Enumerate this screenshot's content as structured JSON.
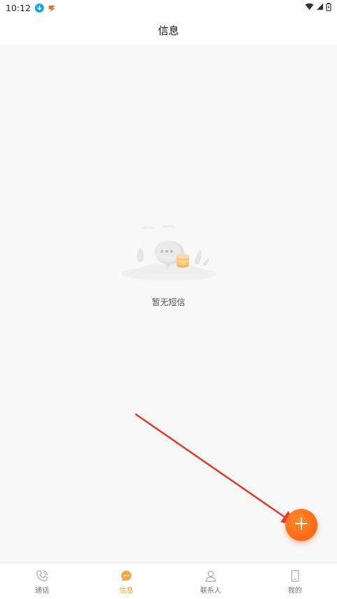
{
  "status_bar": {
    "time": "10:12"
  },
  "header": {
    "title": "信息"
  },
  "empty_state": {
    "text": "暂无短信"
  },
  "tabs": [
    {
      "label": "通话",
      "icon": "phone-icon",
      "active": false
    },
    {
      "label": "信息",
      "icon": "message-icon",
      "active": true
    },
    {
      "label": "联系人",
      "icon": "contact-icon",
      "active": false
    },
    {
      "label": "我的",
      "icon": "mobile-icon",
      "active": false
    }
  ],
  "fab": {
    "icon": "plus-icon"
  },
  "colors": {
    "accent": "#ff6a1a",
    "active_tab": "#f39a2b",
    "annotation_arrow": "#e03b2b"
  }
}
